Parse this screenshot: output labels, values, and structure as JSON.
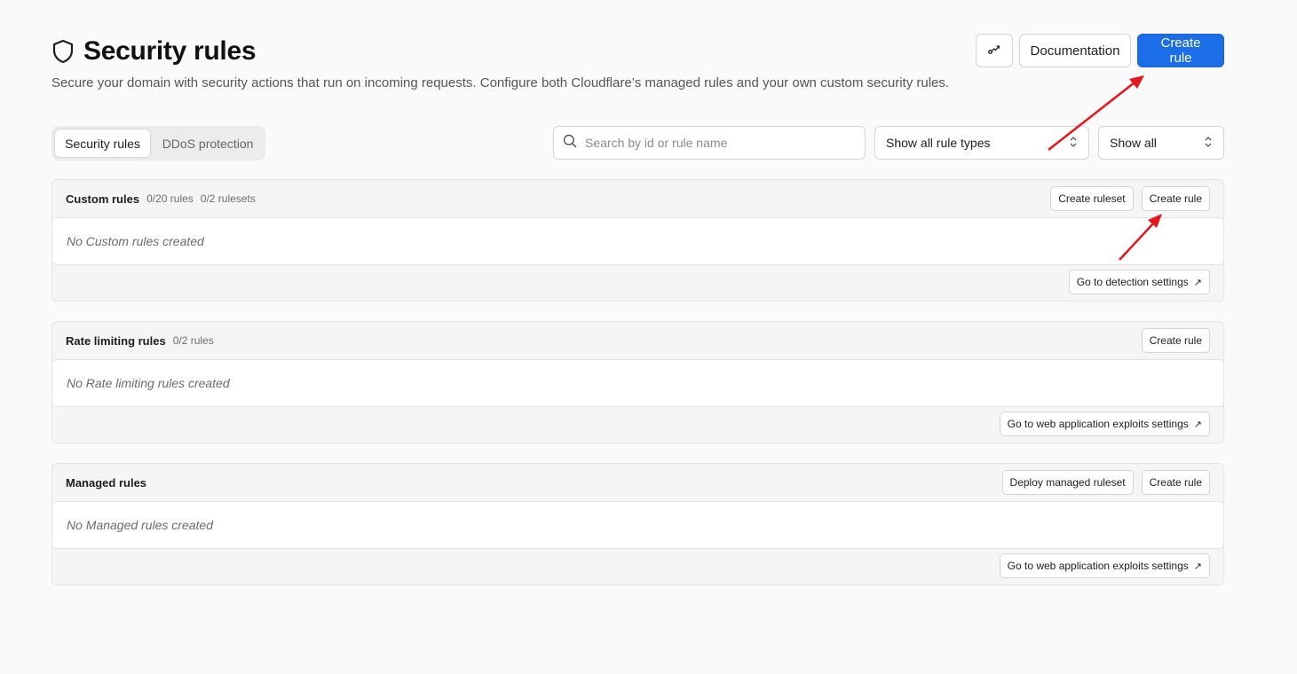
{
  "page": {
    "title": "Security rules",
    "subtitle": "Secure your domain with security actions that run on incoming requests. Configure both Cloudflare’s managed rules and your own custom security rules.",
    "icon": "shield-icon"
  },
  "header_actions": {
    "trace_icon": "trace-icon",
    "documentation_label": "Documentation",
    "create_rule_label": "Create rule",
    "accent_color": "#1c6de8"
  },
  "tabs": [
    {
      "label": "Security rules",
      "active": true
    },
    {
      "label": "DDoS protection",
      "active": false
    }
  ],
  "search": {
    "placeholder": "Search by id or rule name",
    "value": ""
  },
  "filters": {
    "rule_type": "Show all rule types",
    "status": "Show all"
  },
  "sections": [
    {
      "title": "Custom rules",
      "meta": [
        "0/20 rules",
        "0/2 rulesets"
      ],
      "actions": [
        "Create ruleset",
        "Create rule"
      ],
      "empty_text": "No Custom rules created",
      "footer_link": "Go to detection settings"
    },
    {
      "title": "Rate limiting rules",
      "meta": [
        "0/2 rules"
      ],
      "actions": [
        "Create rule"
      ],
      "empty_text": "No Rate limiting rules created",
      "footer_link": "Go to web application exploits settings"
    },
    {
      "title": "Managed rules",
      "meta": [],
      "actions": [
        "Deploy managed ruleset",
        "Create rule"
      ],
      "empty_text": "No Managed rules created",
      "footer_link": "Go to web application exploits settings"
    }
  ],
  "annotation_color": "#e8141c"
}
